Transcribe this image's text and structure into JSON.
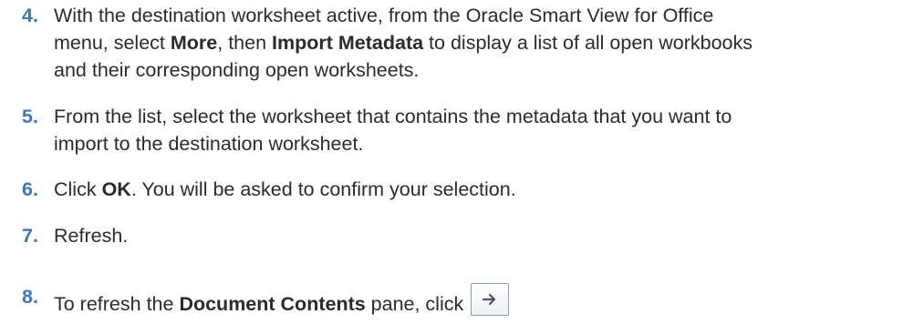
{
  "steps": [
    {
      "number": "4.",
      "lines": {
        "l1_a": "With the destination worksheet active, from the Oracle Smart View for Office",
        "l2_a": "menu, select ",
        "l2_b": "More",
        "l2_c": ", then ",
        "l2_d": "Import Metadata",
        "l2_e": " to display a list of all open workbooks",
        "l3_a": "and their corresponding open worksheets."
      }
    },
    {
      "number": "5.",
      "lines": {
        "l1_a": "From the list, select the worksheet that contains the metadata that you want to",
        "l2_a": "import to the destination worksheet."
      }
    },
    {
      "number": "6.",
      "lines": {
        "a": "Click ",
        "b": "OK",
        "c": ". You will be asked to confirm your selection."
      }
    },
    {
      "number": "7.",
      "lines": {
        "a": "Refresh."
      }
    },
    {
      "number": "8.",
      "lines": {
        "a": "To refresh the ",
        "b": "Document Contents",
        "c": " pane, click "
      },
      "button_icon": "arrow-right-icon"
    }
  ],
  "colors": {
    "number": "#3e79b3",
    "text": "#2b2b2b",
    "button_border": "#8e9bae",
    "arrow": "#4a5566"
  }
}
